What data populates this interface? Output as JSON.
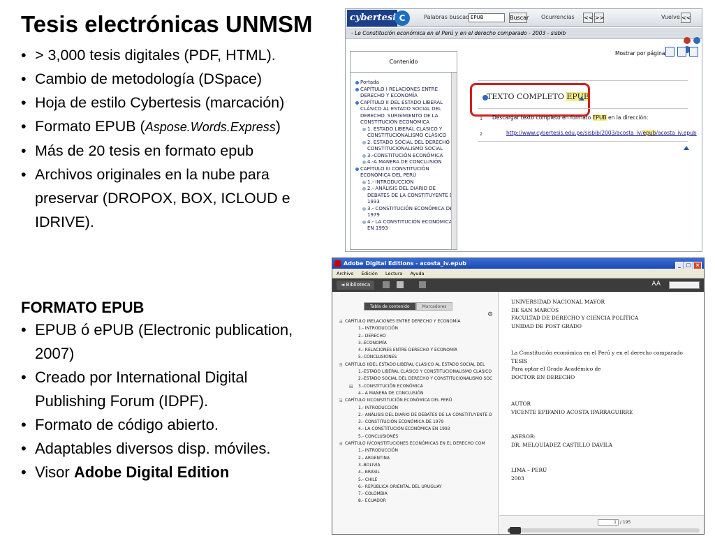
{
  "slide": {
    "title": "Tesis electrónicas UNMSM",
    "bullets_top": [
      "> 3,000 tesis digitales (PDF, HTML).",
      "Cambio de metodología (DSpace)",
      "Hoja de estilo Cybertesis (marcación)",
      {
        "text": "Formato EPUB (",
        "italic": "Aspose.Words.Express",
        "after": ")"
      },
      "Más de 20 tesis en formato epub",
      "Archivos originales en la nube para preservar (DROPOX, BOX, ICLOUD e IDRIVE)."
    ],
    "section_heading": "FORMATO EPUB",
    "bullets_bottom": [
      "EPUB ó ePUB (Electronic publication, 2007)",
      "Creado por International Digital Publishing Forum (IDPF).",
      "Formato de código abierto.",
      "Adaptables diversos disp. móviles.",
      {
        "text": "Visor ",
        "bold": "Adobe Digital Edition",
        "after": ""
      }
    ]
  },
  "cybertesis": {
    "logo": "cybertesis",
    "logo_sub": "PERÚ",
    "search_label": "Palabras buscadas",
    "search_value": "EPUB",
    "search_button": "Buscar",
    "occurrences_label": "Ocurrencias",
    "prev_button": "<<",
    "next_button": ">>",
    "back_label": "Vuelve",
    "back_button": "<<",
    "breadcrumb": "- Le Constitución económica en el Perú y en el derecho comparado - 2003 - sisbib",
    "show_pages": "Mostrar por páginas",
    "sidebar_header": "Contenido",
    "toc": [
      {
        "text": "Portada",
        "level": 0
      },
      {
        "text": "CAPÍTULO I RELACIONES ENTRE DERECHO Y ECONOMÍA",
        "level": 0
      },
      {
        "text": "CAPÍTULO II DEL ESTADO LIBERAL CLÁSICO AL ESTADO SOCIAL DEL DERECHO. SURGIMIENTO DE LA CONSTITUCIÓN ECONÓMICA",
        "level": 0
      },
      {
        "text": "1. ESTADO LIBERAL CLÁSICO Y CONSTITUCIONALISMO CLÁSICO",
        "level": 1
      },
      {
        "text": "2. ESTADO SOCIAL DEL DERECHO Y CONSTITUCIONALISMO SOCIAL",
        "level": 1
      },
      {
        "text": "3.-CONSTITUCIÓN ECONÓMICA",
        "level": 1
      },
      {
        "text": "4.-A MANERA DE CONCLUSIÓN",
        "level": 1
      },
      {
        "text": "CAPÍTULO III CONSTITUCIÓN ECONÓMICA DEL PERÚ",
        "level": 0
      },
      {
        "text": "1.- INTRODUCCIÓN",
        "level": 1
      },
      {
        "text": "2.- ANÁLISIS DEL DIARIO DE DEBATES DE LA CONSTITUYENTE DE 1933",
        "level": 1
      },
      {
        "text": "3.- CONSTITUCIÓN ECONÓMICA DE 1979",
        "level": 1
      },
      {
        "text": "4.- LA CONSTITUCIÓN ECONÓMICA EN 1993",
        "level": 1
      }
    ],
    "texto_completo_before": "TEXTO COMPLETO ",
    "texto_completo_hl": "EPUB",
    "row1_num": "1",
    "download_before": "Descargar texto completo en formato ",
    "download_hl": "EPUB",
    "download_after": " en la dirección:",
    "row2_num": "2",
    "url_before": "http://www.cybertesis.edu.pe/sisbib/2003/acosta_iv/",
    "url_hl": "epub",
    "url_after": "/acosta_iv.epub"
  },
  "ade": {
    "window_title": "Adobe Digital Editions - acosta_iv.epub",
    "window_buttons": [
      "_",
      "□",
      "×"
    ],
    "menu": [
      "Archivo",
      "Edición",
      "Lectura",
      "Ayuda"
    ],
    "library_button": "◄ Biblioteca",
    "font_size_label": "AA",
    "tab_contents": "Tabla de contenido",
    "tab_bookmarks": "Marcadores",
    "gear_icon_glyph": "⚙",
    "toc": [
      {
        "text": "CAPÍTULO IRELACIONES ENTRE DERECHO Y ECONOMÍA",
        "kind": "chapter"
      },
      {
        "text": "1.- INTRODUCCIÓN",
        "kind": "sub"
      },
      {
        "text": "2.- DERECHO",
        "kind": "sub"
      },
      {
        "text": "3.-ECONOMÍA",
        "kind": "sub"
      },
      {
        "text": "4.- RELACIONES ENTRE DERECHO Y ECONOMÍA",
        "kind": "sub"
      },
      {
        "text": "5.-CONCLUSIONES",
        "kind": "sub"
      },
      {
        "text": "CAPÍTULO IIDEL ESTADO LIBERAL CLÁSICO AL ESTADO SOCIAL DEL",
        "kind": "chapter"
      },
      {
        "text": "1.-ESTADO LIBERAL CLÁSICO Y CONSTITUCIONALISMO CLÁSICO",
        "kind": "sub"
      },
      {
        "text": "2.-ESTADO SOCIAL DEL DERECHO Y CONSTITUCIONALISMO SOC",
        "kind": "sub"
      },
      {
        "text": "3.-CONSTITUCIÓN ECONÓMICA",
        "kind": "subplus"
      },
      {
        "text": "4.- A MANERA DE CONCLUSIÓN",
        "kind": "sub"
      },
      {
        "text": "CAPÍTULO IIICONSTITUCIÓN ECONÓMICA DEL PERÚ",
        "kind": "chapter"
      },
      {
        "text": "1.- INTRODUCCIÓN",
        "kind": "sub"
      },
      {
        "text": "2.- ANÁLISIS DEL DIARIO DE DEBATES DE LA CONSTITUYENTE D",
        "kind": "sub"
      },
      {
        "text": "3.- CONSTITUCIÓN ECONÓMICA DE 1979",
        "kind": "sub"
      },
      {
        "text": "4.- LA CONSTITUCIÓN ECONÓMICA EN 1993",
        "kind": "sub"
      },
      {
        "text": "5.- CONCLUSIONES",
        "kind": "sub"
      },
      {
        "text": "CAPÍTULO IVCONSTITUCIONES ECONÓMICAS EN EL DERECHO COM",
        "kind": "chapter"
      },
      {
        "text": "1.- INTRODUCCIÓN",
        "kind": "sub"
      },
      {
        "text": "2.- ARGENTINA",
        "kind": "sub"
      },
      {
        "text": "3.-BOLIVIA",
        "kind": "sub"
      },
      {
        "text": "4.- BRASIL",
        "kind": "sub"
      },
      {
        "text": "5.- CHILE",
        "kind": "sub"
      },
      {
        "text": "6.- REPÚBLICA ORIENTAL DEL URUGUAY",
        "kind": "sub"
      },
      {
        "text": "7.- COLOMBIA",
        "kind": "sub"
      },
      {
        "text": "8.- ECUADOR",
        "kind": "sub"
      }
    ],
    "page": {
      "university": [
        "UNIVERSIDAD NACIONAL MAYOR",
        "DE SAN MARCOS",
        "FACULTAD DE DERECHO Y CIENCIA POLÍTICA",
        "UNIDAD DE POST GRADO"
      ],
      "thesis": [
        "La Constitución económica en el Perú y en el derecho comparado",
        "TESIS",
        "Para optar el Grado Académico de",
        "DOCTOR EN DERECHO"
      ],
      "author": [
        "AUTOR",
        "VICENTE EPIFANIO ACOSTA IPARRAGUIRRE"
      ],
      "advisor": [
        "ASESOR:",
        "DR. MELQUÍADEZ CASTILLO DÁVILA"
      ],
      "place": [
        "LIMA – PERÚ",
        "2003"
      ]
    },
    "page_current": "1",
    "page_total": "/ 195",
    "reading_progress": 0.01
  }
}
